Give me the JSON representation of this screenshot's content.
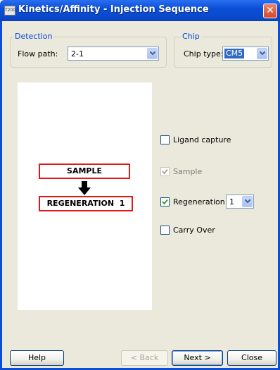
{
  "window": {
    "app_icon_text": "T200",
    "title": "Kinetics/Affinity - Injection Sequence",
    "close_glyph": "✕"
  },
  "detection": {
    "group_label": "Detection",
    "flow_path_label": "Flow path:",
    "flow_path_value": "2-1"
  },
  "chip": {
    "group_label": "Chip",
    "chip_type_label": "Chip type:",
    "chip_type_value": "CM5"
  },
  "sequence": {
    "sample_box": "SAMPLE",
    "regeneration_box": "REGENERATION  1"
  },
  "options": {
    "ligand_capture": {
      "label": "Ligand capture",
      "checked": false,
      "enabled": true
    },
    "sample": {
      "label": "Sample",
      "checked": true,
      "enabled": false
    },
    "regeneration": {
      "label": "Regeneration",
      "checked": true,
      "enabled": true,
      "count": "1"
    },
    "carry_over": {
      "label": "Carry Over",
      "checked": false,
      "enabled": true
    }
  },
  "buttons": {
    "help": "Help",
    "back": "< Back",
    "next": "Next >",
    "close": "Close"
  },
  "colors": {
    "titlebar": "#0b4fd8",
    "group_label": "#0046d5",
    "sequence_box_border": "#e01818",
    "dialog_background": "#ebe9db",
    "selection": "#316ac5"
  }
}
